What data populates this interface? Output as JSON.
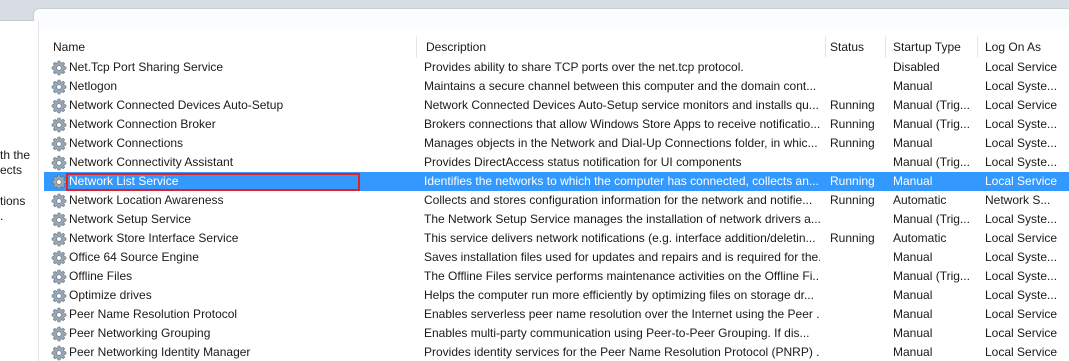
{
  "left_pane": {
    "lines": [
      "th the",
      "ects",
      "tions",
      "."
    ]
  },
  "columns": {
    "name": "Name",
    "description": "Description",
    "status": "Status",
    "startup_type": "Startup Type",
    "log_on_as": "Log On As"
  },
  "sort_indicator": "^",
  "services": [
    {
      "name": "Net.Tcp Port Sharing Service",
      "description": "Provides ability to share TCP ports over the net.tcp protocol.",
      "status": "",
      "startup": "Disabled",
      "logon": "Local Service"
    },
    {
      "name": "Netlogon",
      "description": "Maintains a secure channel between this computer and the domain cont...",
      "status": "",
      "startup": "Manual",
      "logon": "Local Syste..."
    },
    {
      "name": "Network Connected Devices Auto-Setup",
      "description": "Network Connected Devices Auto-Setup service monitors and installs qu...",
      "status": "Running",
      "startup": "Manual (Trig...",
      "logon": "Local Service"
    },
    {
      "name": "Network Connection Broker",
      "description": "Brokers connections that allow Windows Store Apps to receive notificatio...",
      "status": "Running",
      "startup": "Manual (Trig...",
      "logon": "Local Syste..."
    },
    {
      "name": "Network Connections",
      "description": "Manages objects in the Network and Dial-Up Connections folder, in whic...",
      "status": "Running",
      "startup": "Manual",
      "logon": "Local Syste..."
    },
    {
      "name": "Network Connectivity Assistant",
      "description": "Provides DirectAccess status notification for UI components",
      "status": "",
      "startup": "Manual (Trig...",
      "logon": "Local Syste..."
    },
    {
      "name": "Network List Service",
      "description": "Identifies the networks to which the computer has connected, collects an...",
      "status": "Running",
      "startup": "Manual",
      "logon": "Local Service"
    },
    {
      "name": "Network Location Awareness",
      "description": "Collects and stores configuration information for the network and notifie...",
      "status": "Running",
      "startup": "Automatic",
      "logon": "Network S..."
    },
    {
      "name": "Network Setup Service",
      "description": "The Network Setup Service manages the installation of network drivers a...",
      "status": "",
      "startup": "Manual (Trig...",
      "logon": "Local Syste..."
    },
    {
      "name": "Network Store Interface Service",
      "description": "This service delivers network notifications (e.g. interface addition/deletin...",
      "status": "Running",
      "startup": "Automatic",
      "logon": "Local Service"
    },
    {
      "name": "Office 64 Source Engine",
      "description": "Saves installation files used for updates and repairs and is required for the...",
      "status": "",
      "startup": "Manual",
      "logon": "Local Syste..."
    },
    {
      "name": "Offline Files",
      "description": "The Offline Files service performs maintenance activities on the Offline Fi...",
      "status": "",
      "startup": "Manual (Trig...",
      "logon": "Local Syste..."
    },
    {
      "name": "Optimize drives",
      "description": "Helps the computer run more efficiently by optimizing files on storage dr...",
      "status": "",
      "startup": "Manual",
      "logon": "Local Syste..."
    },
    {
      "name": "Peer Name Resolution Protocol",
      "description": "Enables serverless peer name resolution over the Internet using the Peer ...",
      "status": "",
      "startup": "Manual",
      "logon": "Local Service"
    },
    {
      "name": "Peer Networking Grouping",
      "description": "Enables multi-party communication using Peer-to-Peer Grouping.  If dis...",
      "status": "",
      "startup": "Manual",
      "logon": "Local Service"
    },
    {
      "name": "Peer Networking Identity Manager",
      "description": "Provides identity services for the Peer Name Resolution Protocol (PNRP) ...",
      "status": "",
      "startup": "Manual",
      "logon": "Local Service"
    }
  ],
  "selected_index": 6,
  "colors": {
    "selection": "#3399ff",
    "highlight_box": "#e3202a"
  }
}
